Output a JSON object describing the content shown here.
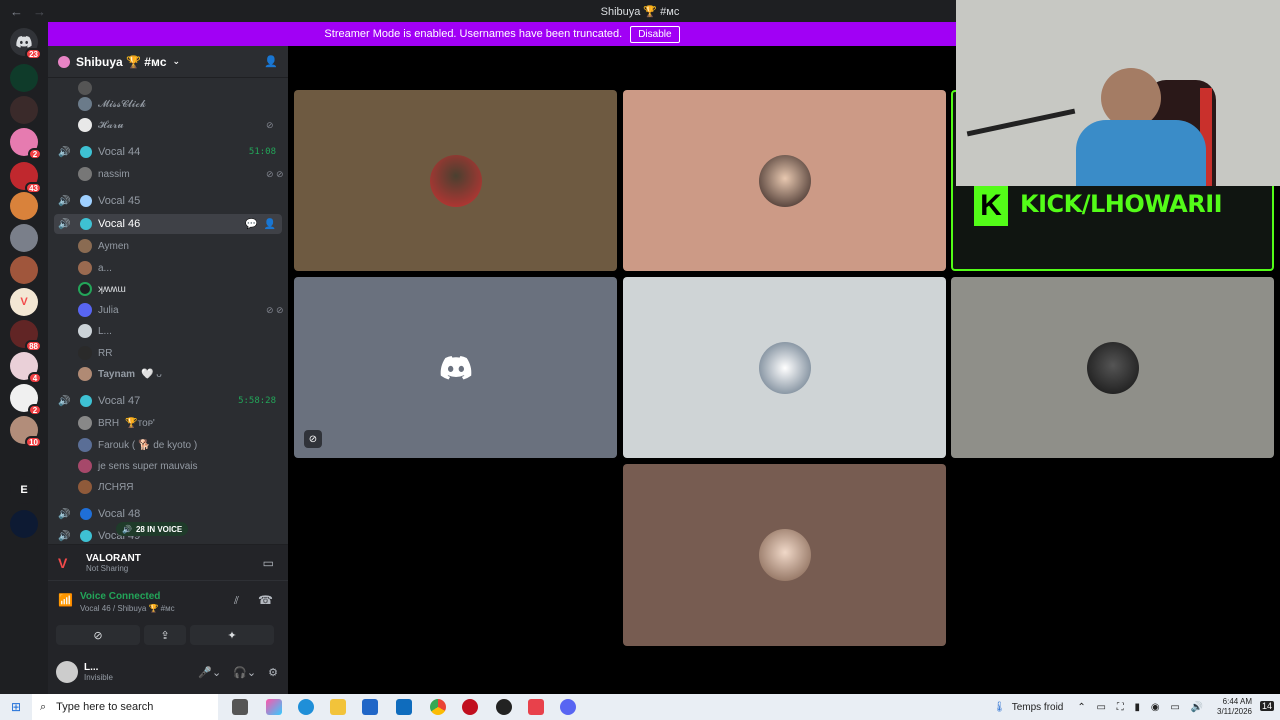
{
  "window": {
    "title": "Shibuya 🏆 #ᴍᴄ",
    "back_label": "←",
    "forward_label": "→"
  },
  "banner": {
    "text": "Streamer Mode is enabled. Usernames have been truncated.",
    "button_label": "Disable"
  },
  "rail": {
    "badges": [
      "23",
      "2",
      "43",
      "88",
      "4",
      "2",
      "10"
    ],
    "letter_server": "E"
  },
  "guild": {
    "name": "Shibuya 🏆 #ᴍᴄ"
  },
  "channels": {
    "top_users": [
      "𝓜𝓲𝓼𝓼𝓒𝓵𝓲𝓬𝓴",
      "𝓗𝓪𝓻𝓾"
    ],
    "vocal44": {
      "name": "Vocal 44",
      "time": "51:08",
      "users": [
        "nassim"
      ]
    },
    "vocal45": {
      "name": "Vocal 45"
    },
    "vocal46": {
      "name": "Vocal 46",
      "users": [
        "Aymen",
        "a...",
        "ʞʍʍɯ",
        "Julia",
        "L...",
        "RR",
        "Taynam"
      ],
      "taynam_suffix": "🤍 ᴗ"
    },
    "vocal47": {
      "name": "Vocal 47",
      "time": "5:58:28",
      "users": [
        "BRH",
        "Farouk ( 🐕 de kyoto )",
        "je sens super mauvais",
        "ЛСНЯЯ"
      ],
      "brh_suffix": "🏆ᴛᴏᴘ'"
    },
    "vocal48": {
      "name": "Vocal 48"
    },
    "vocal49": {
      "name": "Vocal 49"
    },
    "in_voice": "28 IN VOICE"
  },
  "game": {
    "name": "VALORANT",
    "status": "Not Sharing"
  },
  "voice": {
    "title": "Voice Connected",
    "sub": "Vocal 46 / Shibuya 🏆 #ᴍᴄ"
  },
  "user": {
    "name": "L...",
    "status": "Invisible"
  },
  "stream": {
    "kick_text": "KICK/LHOWARII",
    "kick_logo": "K"
  },
  "taskbar": {
    "search_placeholder": "Type here to search",
    "weather": "Temps froid",
    "time": "6:44 AM",
    "date": "3/11/2026",
    "notif_count": "14"
  }
}
